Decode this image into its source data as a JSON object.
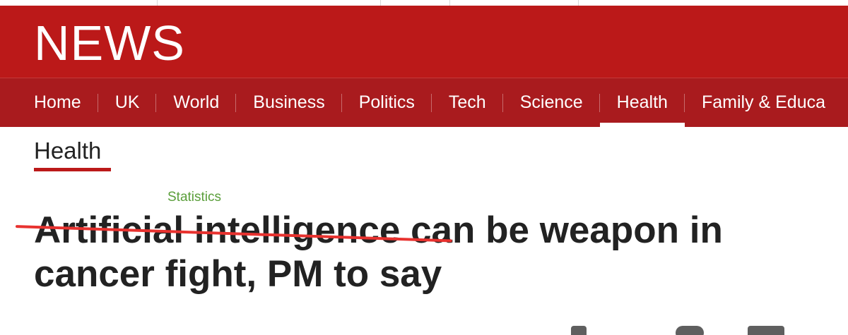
{
  "masthead": {
    "logo_text": "NEWS",
    "brand_color": "#bb1919"
  },
  "nav": {
    "items": [
      {
        "label": "Home"
      },
      {
        "label": "UK"
      },
      {
        "label": "World"
      },
      {
        "label": "Business"
      },
      {
        "label": "Politics"
      },
      {
        "label": "Tech"
      },
      {
        "label": "Science"
      },
      {
        "label": "Health",
        "active": true
      },
      {
        "label": "Family & Educa"
      }
    ]
  },
  "section": {
    "title": "Health"
  },
  "article": {
    "tag": "Statistics",
    "headline_struck": "Artificial intelligence",
    "headline_rest": " can be weapon in cancer fight, PM to say",
    "strike_color": "#e8322f"
  },
  "share": {
    "icons": [
      "facebook-icon",
      "messenger-icon",
      "twitter-icon"
    ]
  }
}
